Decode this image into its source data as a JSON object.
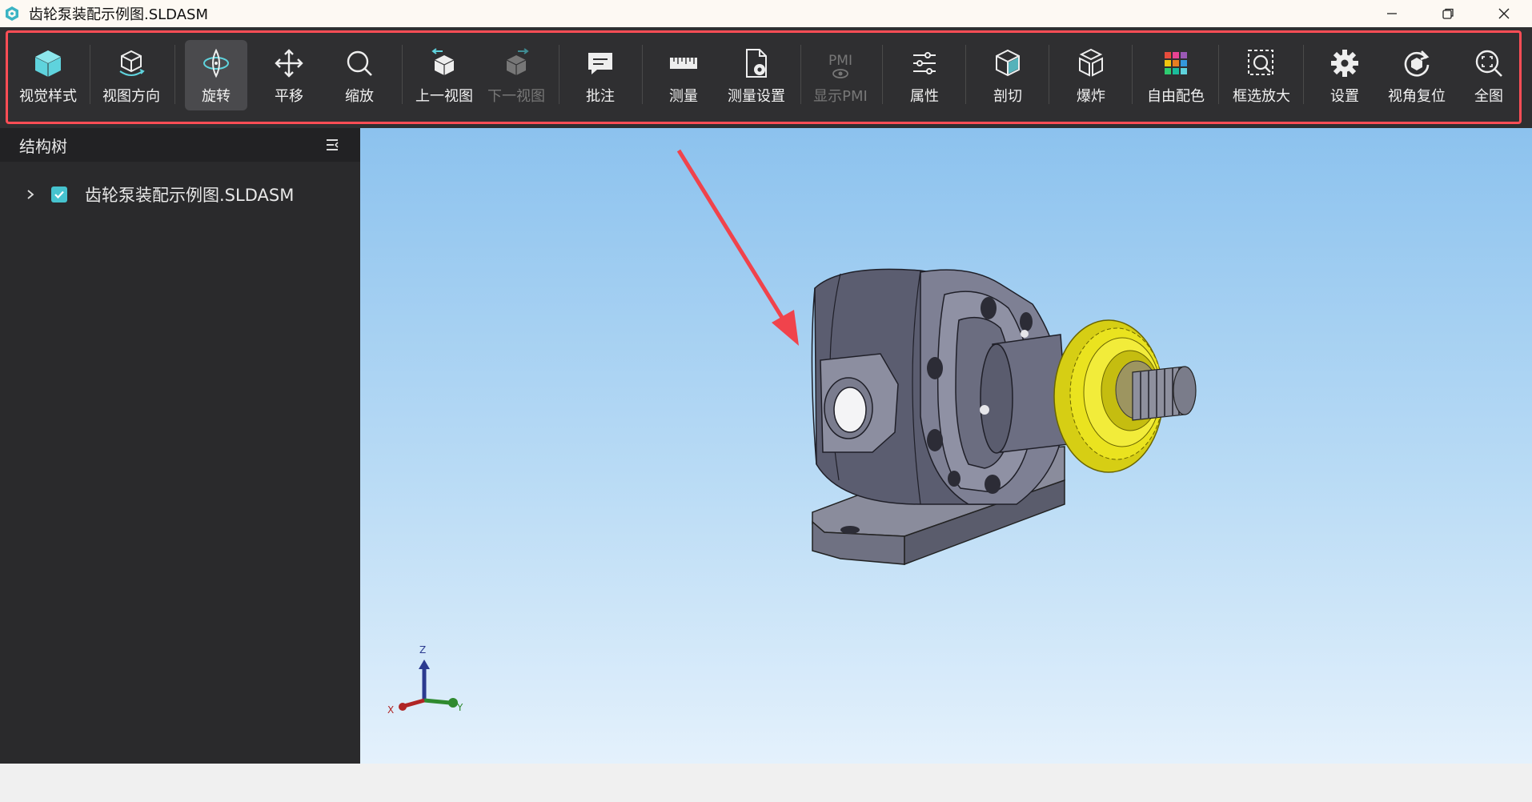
{
  "window": {
    "title": "齿轮泵装配示例图.SLDASM",
    "controls": [
      "minimize",
      "restore",
      "close"
    ]
  },
  "toolbar": {
    "items": [
      {
        "label": "视觉样式",
        "icon": "cube-solid-icon"
      },
      {
        "label": "视图方向",
        "icon": "view-orient-icon"
      },
      {
        "label": "旋转",
        "icon": "rotate-icon",
        "active": true
      },
      {
        "label": "平移",
        "icon": "pan-icon"
      },
      {
        "label": "缩放",
        "icon": "zoom-icon"
      },
      {
        "label": "上一视图",
        "icon": "prev-view-icon"
      },
      {
        "label": "下一视图",
        "icon": "next-view-icon",
        "disabled": true
      },
      {
        "label": "批注",
        "icon": "comment-icon"
      },
      {
        "label": "测量",
        "icon": "ruler-icon"
      },
      {
        "label": "测量设置",
        "icon": "measure-settings-icon"
      },
      {
        "label": "显示PMI",
        "icon": "pmi-icon",
        "disabled": true
      },
      {
        "label": "属性",
        "icon": "properties-icon"
      },
      {
        "label": "剖切",
        "icon": "section-icon"
      },
      {
        "label": "爆炸",
        "icon": "explode-icon"
      },
      {
        "label": "自由配色",
        "icon": "color-grid-icon"
      },
      {
        "label": "框选放大",
        "icon": "box-zoom-icon"
      },
      {
        "label": "设置",
        "icon": "gear-icon"
      },
      {
        "label": "视角复位",
        "icon": "reset-view-icon"
      },
      {
        "label": "全图",
        "icon": "fit-all-icon"
      }
    ],
    "pmi_icon_text": "PMI"
  },
  "sidebar": {
    "title": "结构树",
    "tree": [
      {
        "label": "齿轮泵装配示例图.SLDASM",
        "checked": true,
        "expanded": false
      }
    ]
  },
  "viewport": {
    "axes": {
      "x": "X",
      "y": "Y",
      "z": "Z"
    }
  },
  "colors": {
    "toolbar_bg": "#2f2f31",
    "highlight_frame": "#ff4d55",
    "checkbox": "#46c3cf",
    "gear": "#e8e01a",
    "housing": "#6b6d80"
  }
}
